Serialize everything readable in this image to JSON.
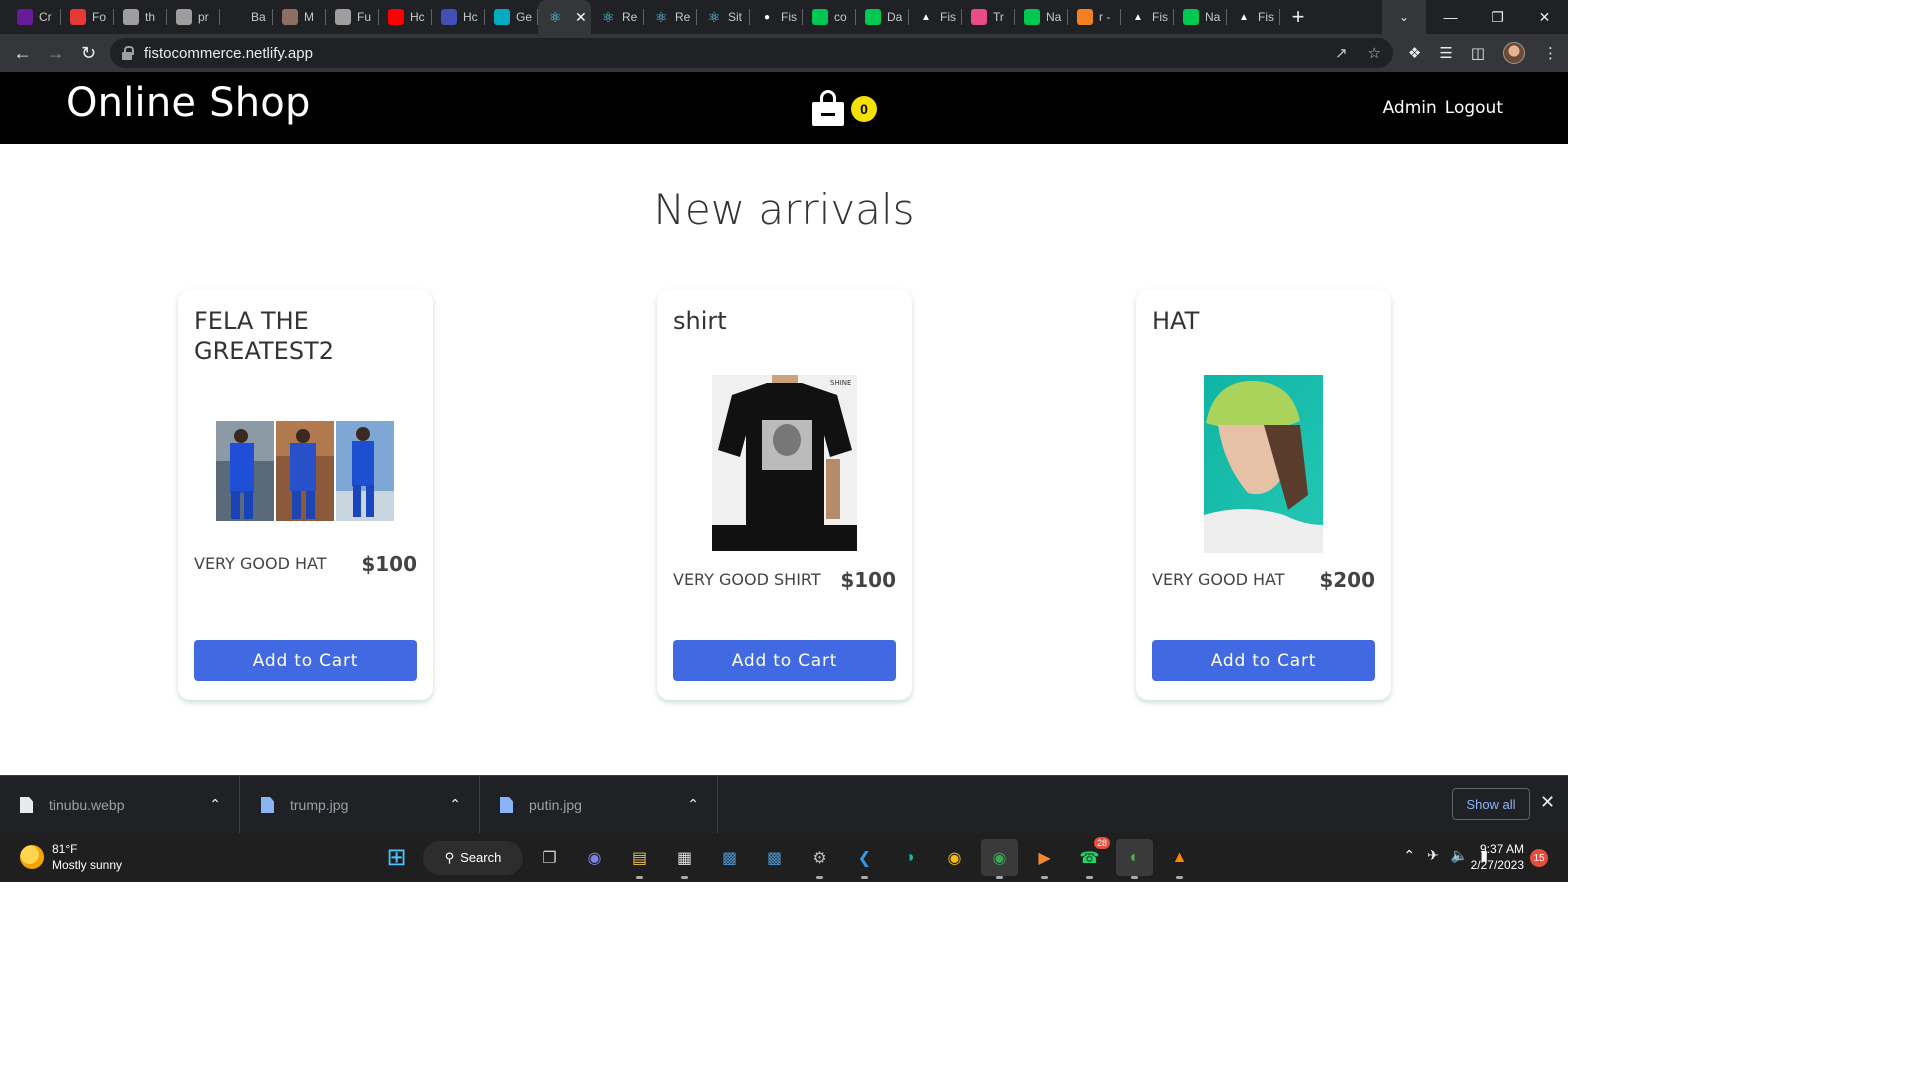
{
  "browser": {
    "tabs": [
      {
        "label": "Cr",
        "icon": "purple-circle-icon",
        "color": "#6a1b9a"
      },
      {
        "label": "Fo",
        "icon": "red-box-icon",
        "color": "#e53935"
      },
      {
        "label": "th",
        "icon": "document-icon",
        "color": "#9e9e9e"
      },
      {
        "label": "pr",
        "icon": "document-icon",
        "color": "#9e9e9e"
      },
      {
        "label": "Ba",
        "icon": "bold-b-icon",
        "color": "#202124"
      },
      {
        "label": "M",
        "icon": "book-icon",
        "color": "#8d6e63"
      },
      {
        "label": "Fu",
        "icon": "globe-icon",
        "color": "#9e9e9e"
      },
      {
        "label": "Hc",
        "icon": "youtube-icon",
        "color": "#ff0000"
      },
      {
        "label": "Hc",
        "icon": "a-icon",
        "color": "#3f51b5"
      },
      {
        "label": "Ge",
        "icon": "diamond-icon",
        "color": "#00acc1"
      },
      {
        "label": "",
        "icon": "react-icon",
        "color": "#61dafb",
        "active": true
      },
      {
        "label": "Re",
        "icon": "react-icon",
        "color": "#61dafb"
      },
      {
        "label": "Re",
        "icon": "react-icon",
        "color": "#61dafb"
      },
      {
        "label": "Sit",
        "icon": "react-icon",
        "color": "#61dafb"
      },
      {
        "label": "Fis",
        "icon": "github-icon",
        "color": "#ffffff"
      },
      {
        "label": "co",
        "icon": "code-box-icon",
        "color": "#00c853"
      },
      {
        "label": "Da",
        "icon": "leaf-icon",
        "color": "#00c853"
      },
      {
        "label": "Fis",
        "icon": "triangle-icon",
        "color": "#ffffff"
      },
      {
        "label": "Tr",
        "icon": "dribbble-icon",
        "color": "#ea4c89"
      },
      {
        "label": "Na",
        "icon": "netlify-icon",
        "color": "#00c853"
      },
      {
        "label": "r -",
        "icon": "stack-icon",
        "color": "#f48024"
      },
      {
        "label": "Fis",
        "icon": "triangle-icon",
        "color": "#ffffff"
      },
      {
        "label": "Na",
        "icon": "netlify-icon",
        "color": "#00c853"
      },
      {
        "label": "Fis",
        "icon": "triangle-icon",
        "color": "#ffffff"
      }
    ],
    "url": "fistocommerce.netlify.app"
  },
  "site": {
    "brand": "Online Shop",
    "cart_count": "0",
    "nav": {
      "admin": "Admin",
      "logout": "Logout"
    },
    "section_title": "New arrivals",
    "products": [
      {
        "name": "FELA THE GREATEST2",
        "description": "VERY GOOD HAT",
        "price": "$100",
        "button": "Add to Cart",
        "image": "blue-outfit-photos"
      },
      {
        "name": "shirt",
        "description": "VERY GOOD SHIRT",
        "price": "$100",
        "button": "Add to Cart",
        "image": "black-tshirt-photo"
      },
      {
        "name": "HAT",
        "description": "VERY GOOD HAT",
        "price": "$200",
        "button": "Add to Cart",
        "image": "green-bucket-hat-photo"
      }
    ],
    "button_color": "#4169e1",
    "badge_color": "#f5e000"
  },
  "downloads": {
    "items": [
      {
        "name": "tinubu.webp"
      },
      {
        "name": "trump.jpg"
      },
      {
        "name": "putin.jpg"
      }
    ],
    "show_all": "Show all"
  },
  "taskbar": {
    "weather_temp": "81°F",
    "weather_desc": "Mostly sunny",
    "search": "Search",
    "whatsapp_badge": "28",
    "time": "9:37 AM",
    "date": "2/27/2023",
    "notifications": "15"
  }
}
